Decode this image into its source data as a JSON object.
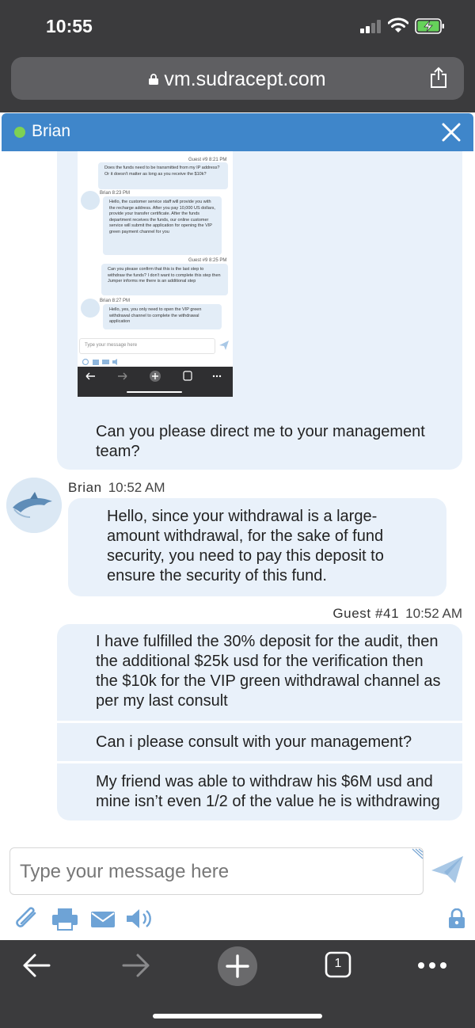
{
  "status_bar": {
    "time": "10:55"
  },
  "browser": {
    "url": "vm.sudracept.com",
    "tab_count": "1"
  },
  "chat": {
    "agent_name": "Brian",
    "screenshot": {
      "guest_label_1": "Guest #9  8:21 PM",
      "msg_1": "Does the funds need to be transmitted from my IP address? Or it doesn't matter as long as you receive the $10k?",
      "brian_label_1": "Brian  8:23 PM",
      "msg_2": "Hello, the customer service staff will provide you with the recharge address. After you pay 10,000 US dollars, provide your transfer certificate. After the funds department receives the funds, our online customer service will submit the application for opening the VIP green payment channel for you",
      "guest_label_2": "Guest #9  8:25 PM",
      "msg_3": "Can you please confirm that this is the last step to withdraw the funds? I don't want to complete this step then Jumper informs me there is an additional step",
      "brian_label_2": "Brian  8:27 PM",
      "msg_4": "Hello, yes, you only need to open the VIP green withdrawal channel to complete the withdrawal application",
      "input_placeholder": "Type your message here",
      "tab_count": "1"
    },
    "messages": [
      {
        "text": "Can you please direct me to your management team?"
      },
      {
        "sender": "Brian",
        "time": "10:52 AM",
        "text": "Hello, since your withdrawal is a large-amount withdrawal, for the sake of fund security, you need to pay this deposit to ensure the security of this fund."
      },
      {
        "sender": "Guest #41",
        "time": "10:52 AM",
        "text": "I have fulfilled the 30% deposit for the audit, then the additional $25k usd for the verification then the $10k for the VIP green withdrawal channel as per my last consult"
      },
      {
        "text": "Can i please consult with your management?"
      },
      {
        "text": "My friend was able to withdraw his $6M usd and mine isn’t even 1/2 of the value he is withdrawing"
      }
    ],
    "composer": {
      "placeholder": "Type your message here"
    }
  },
  "colors": {
    "header": "#3f86ca",
    "bubble": "#e9f1fa",
    "chrome": "#3b3b3d",
    "online": "#7ed154"
  }
}
